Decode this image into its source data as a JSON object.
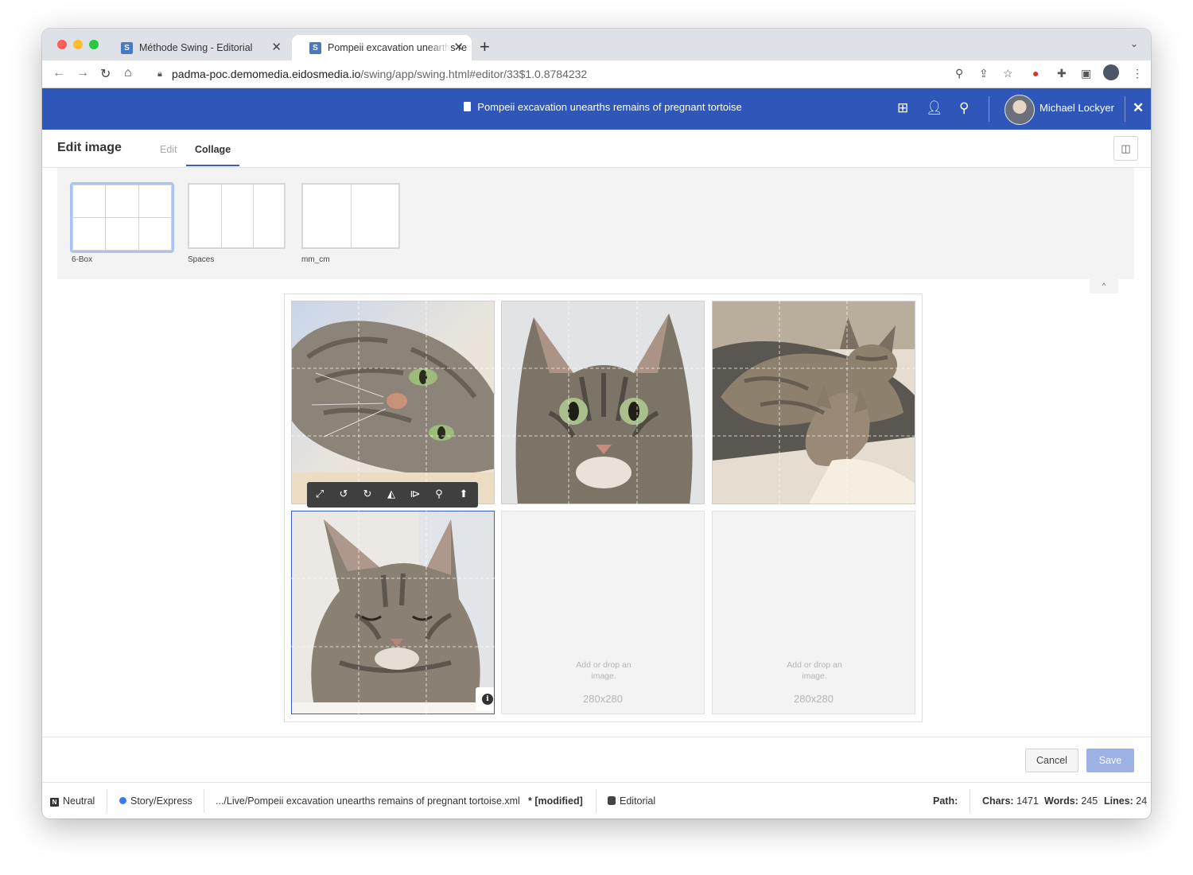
{
  "browser": {
    "tabs": [
      {
        "favicon": "S",
        "title": "Méthode Swing - Editorial"
      },
      {
        "favicon": "S",
        "title": "Pompeii excavation unearths re"
      }
    ],
    "url_host": "padma-poc.demomedia.eidosmedia.io",
    "url_path": "/swing/app/swing.html#editor/33$1.0.8784232"
  },
  "app": {
    "doc_title": "Pompeii excavation unearths remains of pregnant tortoise",
    "user_name": "Michael Lockyer",
    "accent_color": "#2f56b9"
  },
  "editor": {
    "title": "Edit image",
    "tabs": [
      "Edit",
      "Collage"
    ],
    "active_tab": "Collage",
    "templates": [
      {
        "label": "6-Box",
        "selected": true
      },
      {
        "label": "Spaces",
        "selected": false
      },
      {
        "label": "mm_cm",
        "selected": false
      }
    ],
    "empty_slot_text": "Add or drop an image.",
    "empty_slot_size": "280x280",
    "image_toolbar": [
      "fit-icon",
      "rotate-left-icon",
      "rotate-right-icon",
      "flip-horizontal-icon",
      "flip-vertical-icon",
      "zoom-icon",
      "upload-icon"
    ]
  },
  "footer": {
    "cancel_label": "Cancel",
    "save_label": "Save",
    "status": {
      "mode_badge": "N",
      "mode": "Neutral",
      "type": "Story/Express",
      "path": ".../Live/Pompeii excavation unearths remains of pregnant tortoise.xml",
      "modified": "* [modified]",
      "database": "Editorial",
      "path_label": "Path:",
      "chars_label": "Chars:",
      "chars": "1471",
      "words_label": "Words:",
      "words": "245",
      "lines_label": "Lines:",
      "lines": "24"
    }
  }
}
